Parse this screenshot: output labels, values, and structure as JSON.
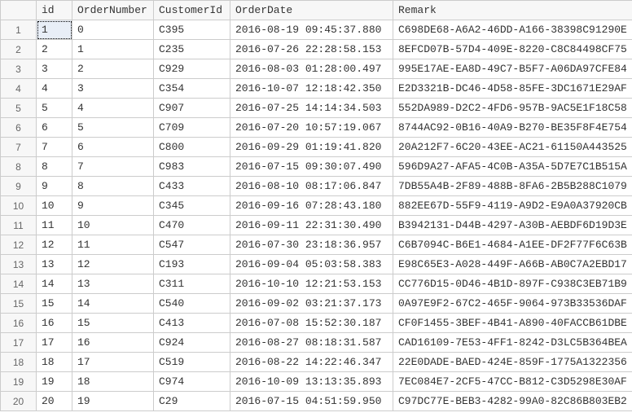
{
  "columns": {
    "id": "id",
    "orderNumber": "OrderNumber",
    "customerId": "CustomerId",
    "orderDate": "OrderDate",
    "remark": "Remark"
  },
  "rows": [
    {
      "n": "1",
      "id": "1",
      "orderNumber": "0",
      "customerId": "C395",
      "orderDate": "2016-08-19 09:45:37.880",
      "remark": "C698DE68-A6A2-46DD-A166-38398C91290E"
    },
    {
      "n": "2",
      "id": "2",
      "orderNumber": "1",
      "customerId": "C235",
      "orderDate": "2016-07-26 22:28:58.153",
      "remark": "8EFCD07B-57D4-409E-8220-C8C84498CF75"
    },
    {
      "n": "3",
      "id": "3",
      "orderNumber": "2",
      "customerId": "C929",
      "orderDate": "2016-08-03 01:28:00.497",
      "remark": "995E17AE-EA8D-49C7-B5F7-A06DA97CFE84"
    },
    {
      "n": "4",
      "id": "4",
      "orderNumber": "3",
      "customerId": "C354",
      "orderDate": "2016-10-07 12:18:42.350",
      "remark": "E2D3321B-DC46-4D58-85FE-3DC1671E29AF"
    },
    {
      "n": "5",
      "id": "5",
      "orderNumber": "4",
      "customerId": "C907",
      "orderDate": "2016-07-25 14:14:34.503",
      "remark": "552DA989-D2C2-4FD6-957B-9AC5E1F18C58"
    },
    {
      "n": "6",
      "id": "6",
      "orderNumber": "5",
      "customerId": "C709",
      "orderDate": "2016-07-20 10:57:19.067",
      "remark": "8744AC92-0B16-40A9-B270-BE35F8F4E754"
    },
    {
      "n": "7",
      "id": "7",
      "orderNumber": "6",
      "customerId": "C800",
      "orderDate": "2016-09-29 01:19:41.820",
      "remark": "20A212F7-6C20-43EE-AC21-61150A443525"
    },
    {
      "n": "8",
      "id": "8",
      "orderNumber": "7",
      "customerId": "C983",
      "orderDate": "2016-07-15 09:30:07.490",
      "remark": "596D9A27-AFA5-4C0B-A35A-5D7E7C1B515A"
    },
    {
      "n": "9",
      "id": "9",
      "orderNumber": "8",
      "customerId": "C433",
      "orderDate": "2016-08-10 08:17:06.847",
      "remark": "7DB55A4B-2F89-488B-8FA6-2B5B288C1079"
    },
    {
      "n": "10",
      "id": "10",
      "orderNumber": "9",
      "customerId": "C345",
      "orderDate": "2016-09-16 07:28:43.180",
      "remark": "882EE67D-55F9-4119-A9D2-E9A0A37920CB"
    },
    {
      "n": "11",
      "id": "11",
      "orderNumber": "10",
      "customerId": "C470",
      "orderDate": "2016-09-11 22:31:30.490",
      "remark": "B3942131-D44B-4297-A30B-AEBDF6D19D3E"
    },
    {
      "n": "12",
      "id": "12",
      "orderNumber": "11",
      "customerId": "C547",
      "orderDate": "2016-07-30 23:18:36.957",
      "remark": "C6B7094C-B6E1-4684-A1EE-DF2F77F6C63B"
    },
    {
      "n": "13",
      "id": "13",
      "orderNumber": "12",
      "customerId": "C193",
      "orderDate": "2016-09-04 05:03:58.383",
      "remark": "E98C65E3-A028-449F-A66B-AB0C7A2EBD17"
    },
    {
      "n": "14",
      "id": "14",
      "orderNumber": "13",
      "customerId": "C311",
      "orderDate": "2016-10-10 12:21:53.153",
      "remark": "CC776D15-0D46-4B1D-897F-C938C3EB71B9"
    },
    {
      "n": "15",
      "id": "15",
      "orderNumber": "14",
      "customerId": "C540",
      "orderDate": "2016-09-02 03:21:37.173",
      "remark": "0A97E9F2-67C2-465F-9064-973B33536DAF"
    },
    {
      "n": "16",
      "id": "16",
      "orderNumber": "15",
      "customerId": "C413",
      "orderDate": "2016-07-08 15:52:30.187",
      "remark": "CF0F1455-3BEF-4B41-A890-40FACCB61DBE"
    },
    {
      "n": "17",
      "id": "17",
      "orderNumber": "16",
      "customerId": "C924",
      "orderDate": "2016-08-27 08:18:31.587",
      "remark": "CAD16109-7E53-4FF1-8242-D3LC5B364BEA"
    },
    {
      "n": "18",
      "id": "18",
      "orderNumber": "17",
      "customerId": "C519",
      "orderDate": "2016-08-22 14:22:46.347",
      "remark": "22E0DADE-BAED-424E-859F-1775A1322356"
    },
    {
      "n": "19",
      "id": "19",
      "orderNumber": "18",
      "customerId": "C974",
      "orderDate": "2016-10-09 13:13:35.893",
      "remark": "7EC084E7-2CF5-47CC-B812-C3D5298E30AF"
    },
    {
      "n": "20",
      "id": "20",
      "orderNumber": "19",
      "customerId": "C29",
      "orderDate": "2016-07-15 04:51:59.950",
      "remark": "C97DC77E-BEB3-4282-99A0-82C86B803EB2"
    }
  ],
  "selected": {
    "row": 0,
    "col": "id"
  }
}
